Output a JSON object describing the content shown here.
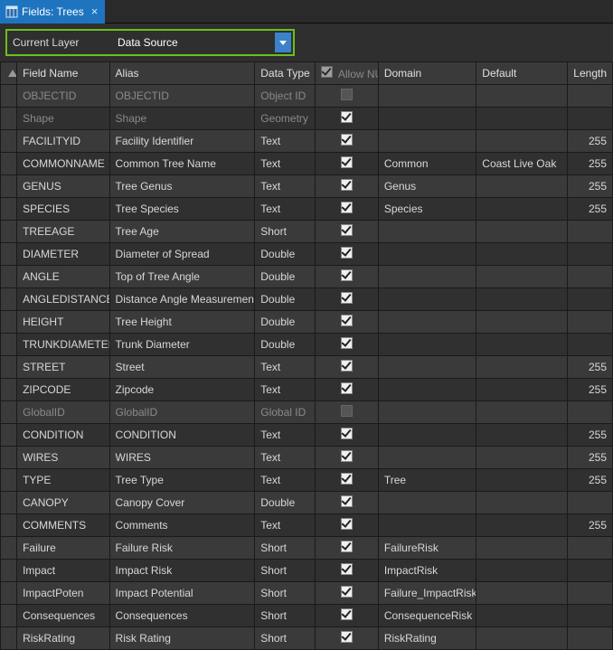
{
  "tab": {
    "title": "Fields: Trees"
  },
  "toolbar": {
    "layer_label": "Current Layer",
    "layer_value": "Data Source"
  },
  "columns": {
    "field": "Field Name",
    "alias": "Alias",
    "dtype": "Data Type",
    "allow_null": "Allow NULL",
    "domain": "Domain",
    "default": "Default",
    "length": "Length"
  },
  "rows": [
    {
      "field": "OBJECTID",
      "alias": "OBJECTID",
      "dtype": "Object ID",
      "null": false,
      "domain": "",
      "default": "",
      "length": "",
      "readonly": true
    },
    {
      "field": "Shape",
      "alias": "Shape",
      "dtype": "Geometry",
      "null": true,
      "domain": "",
      "default": "",
      "length": "",
      "readonly": true
    },
    {
      "field": "FACILITYID",
      "alias": "Facility Identifier",
      "dtype": "Text",
      "null": true,
      "domain": "",
      "default": "",
      "length": "255"
    },
    {
      "field": "COMMONNAME",
      "alias": "Common Tree Name",
      "dtype": "Text",
      "null": true,
      "domain": "Common",
      "default": "Coast Live Oak",
      "length": "255"
    },
    {
      "field": "GENUS",
      "alias": "Tree Genus",
      "dtype": "Text",
      "null": true,
      "domain": "Genus",
      "default": "",
      "length": "255"
    },
    {
      "field": "SPECIES",
      "alias": "Tree Species",
      "dtype": "Text",
      "null": true,
      "domain": "Species",
      "default": "",
      "length": "255"
    },
    {
      "field": "TREEAGE",
      "alias": "Tree Age",
      "dtype": "Short",
      "null": true,
      "domain": "",
      "default": "",
      "length": ""
    },
    {
      "field": "DIAMETER",
      "alias": "Diameter of Spread",
      "dtype": "Double",
      "null": true,
      "domain": "",
      "default": "",
      "length": ""
    },
    {
      "field": "ANGLE",
      "alias": "Top of Tree Angle",
      "dtype": "Double",
      "null": true,
      "domain": "",
      "default": "",
      "length": ""
    },
    {
      "field": "ANGLEDISTANCE",
      "alias": "Distance Angle Measurement",
      "dtype": "Double",
      "null": true,
      "domain": "",
      "default": "",
      "length": ""
    },
    {
      "field": "HEIGHT",
      "alias": "Tree Height",
      "dtype": "Double",
      "null": true,
      "domain": "",
      "default": "",
      "length": ""
    },
    {
      "field": "TRUNKDIAMETER",
      "alias": "Trunk Diameter",
      "dtype": "Double",
      "null": true,
      "domain": "",
      "default": "",
      "length": ""
    },
    {
      "field": "STREET",
      "alias": "Street",
      "dtype": "Text",
      "null": true,
      "domain": "",
      "default": "",
      "length": "255"
    },
    {
      "field": "ZIPCODE",
      "alias": "Zipcode",
      "dtype": "Text",
      "null": true,
      "domain": "",
      "default": "",
      "length": "255"
    },
    {
      "field": "GlobalID",
      "alias": "GlobalID",
      "dtype": "Global ID",
      "null": false,
      "domain": "",
      "default": "",
      "length": "",
      "readonly": true
    },
    {
      "field": "CONDITION",
      "alias": "CONDITION",
      "dtype": "Text",
      "null": true,
      "domain": "",
      "default": "",
      "length": "255"
    },
    {
      "field": "WIRES",
      "alias": "WIRES",
      "dtype": "Text",
      "null": true,
      "domain": "",
      "default": "",
      "length": "255"
    },
    {
      "field": "TYPE",
      "alias": "Tree Type",
      "dtype": "Text",
      "null": true,
      "domain": "Tree",
      "default": "",
      "length": "255"
    },
    {
      "field": "CANOPY",
      "alias": "Canopy Cover",
      "dtype": "Double",
      "null": true,
      "domain": "",
      "default": "",
      "length": ""
    },
    {
      "field": "COMMENTS",
      "alias": "Comments",
      "dtype": "Text",
      "null": true,
      "domain": "",
      "default": "",
      "length": "255"
    },
    {
      "field": "Failure",
      "alias": "Failure Risk",
      "dtype": "Short",
      "null": true,
      "domain": "FailureRisk",
      "default": "",
      "length": ""
    },
    {
      "field": "Impact",
      "alias": "Impact Risk",
      "dtype": "Short",
      "null": true,
      "domain": "ImpactRisk",
      "default": "",
      "length": ""
    },
    {
      "field": "ImpactPoten",
      "alias": "Impact Potential",
      "dtype": "Short",
      "null": true,
      "domain": "Failure_ImpactRisk",
      "default": "",
      "length": ""
    },
    {
      "field": "Consequences",
      "alias": "Consequences",
      "dtype": "Short",
      "null": true,
      "domain": "ConsequenceRisk",
      "default": "",
      "length": ""
    },
    {
      "field": "RiskRating",
      "alias": "Risk Rating",
      "dtype": "Short",
      "null": true,
      "domain": "RiskRating",
      "default": "",
      "length": ""
    }
  ]
}
